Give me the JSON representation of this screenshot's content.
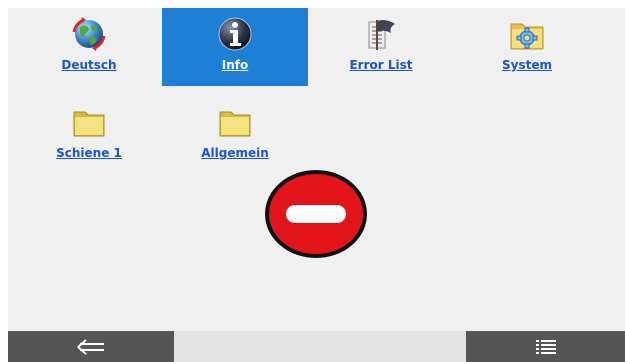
{
  "tiles": [
    {
      "label": "Deutsch",
      "icon": "globe-icon"
    },
    {
      "label": "Info",
      "icon": "info-icon",
      "selected": true
    },
    {
      "label": "Error List",
      "icon": "error-list-icon"
    },
    {
      "label": "System",
      "icon": "system-settings-folder-icon"
    },
    {
      "label": "Schiene 1",
      "icon": "folder-icon"
    },
    {
      "label": "Allgemein",
      "icon": "folder-icon"
    }
  ],
  "status": {
    "icon": "no-entry-icon",
    "color": "#e4141b"
  },
  "bottom_bar": {
    "back_icon": "back-arrow-icon",
    "menu_icon": "menu-list-icon"
  },
  "colors": {
    "selected_tile": "#1e7fd6",
    "link": "#1a55c9",
    "bar": "#555555"
  }
}
